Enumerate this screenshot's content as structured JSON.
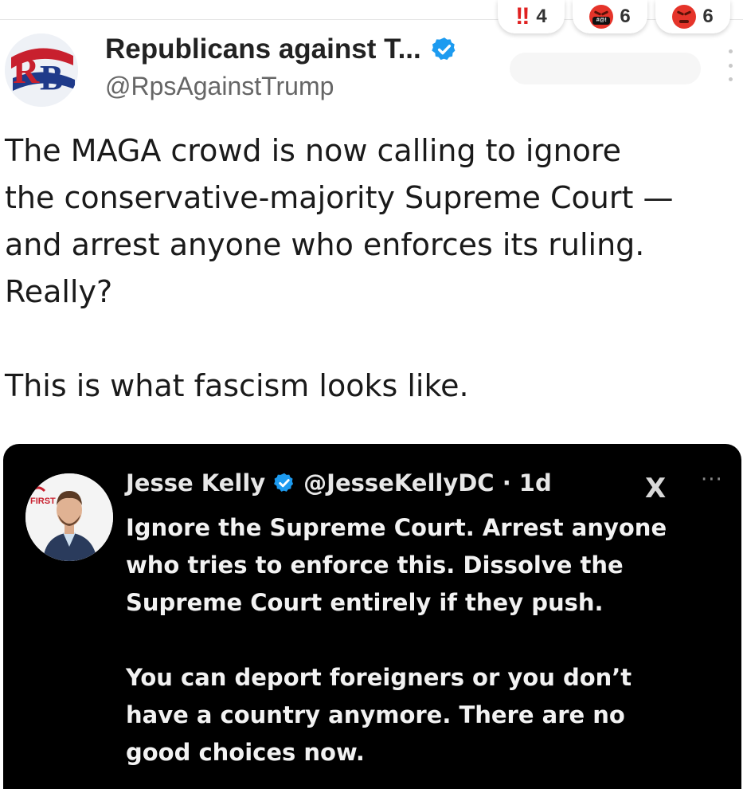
{
  "reactions": [
    {
      "icon": "double-exclamation-icon",
      "count": "4"
    },
    {
      "icon": "cursing-face-icon",
      "count": "6",
      "mask_text": "#@!"
    },
    {
      "icon": "angry-face-icon",
      "count": "6"
    }
  ],
  "tweet": {
    "author_name": "Republicans against T...",
    "author_handle": "@RpsAgainstTrump",
    "avatar_text": "RB",
    "verified_color": "#1d9bf0",
    "lines": [
      "The MAGA crowd is now calling to ignore",
      "the conservative-majority Supreme Court —",
      "and arrest anyone who enforces its ruling.",
      "Really?"
    ],
    "closing": "This is what fascism looks like."
  },
  "quoted": {
    "name": "Jesse Kelly",
    "handle_time": "@JesseKellyDC · 1d",
    "logo_text": "X",
    "avatar_badge": "FIRST",
    "paragraph1": [
      "Ignore the Supreme Court. Arrest anyone",
      "who tries to enforce this. Dissolve the",
      "Supreme Court entirely if they push."
    ],
    "paragraph2": [
      "You can deport foreigners or you don’t",
      "have a country anymore. There are no",
      "good choices now."
    ]
  }
}
